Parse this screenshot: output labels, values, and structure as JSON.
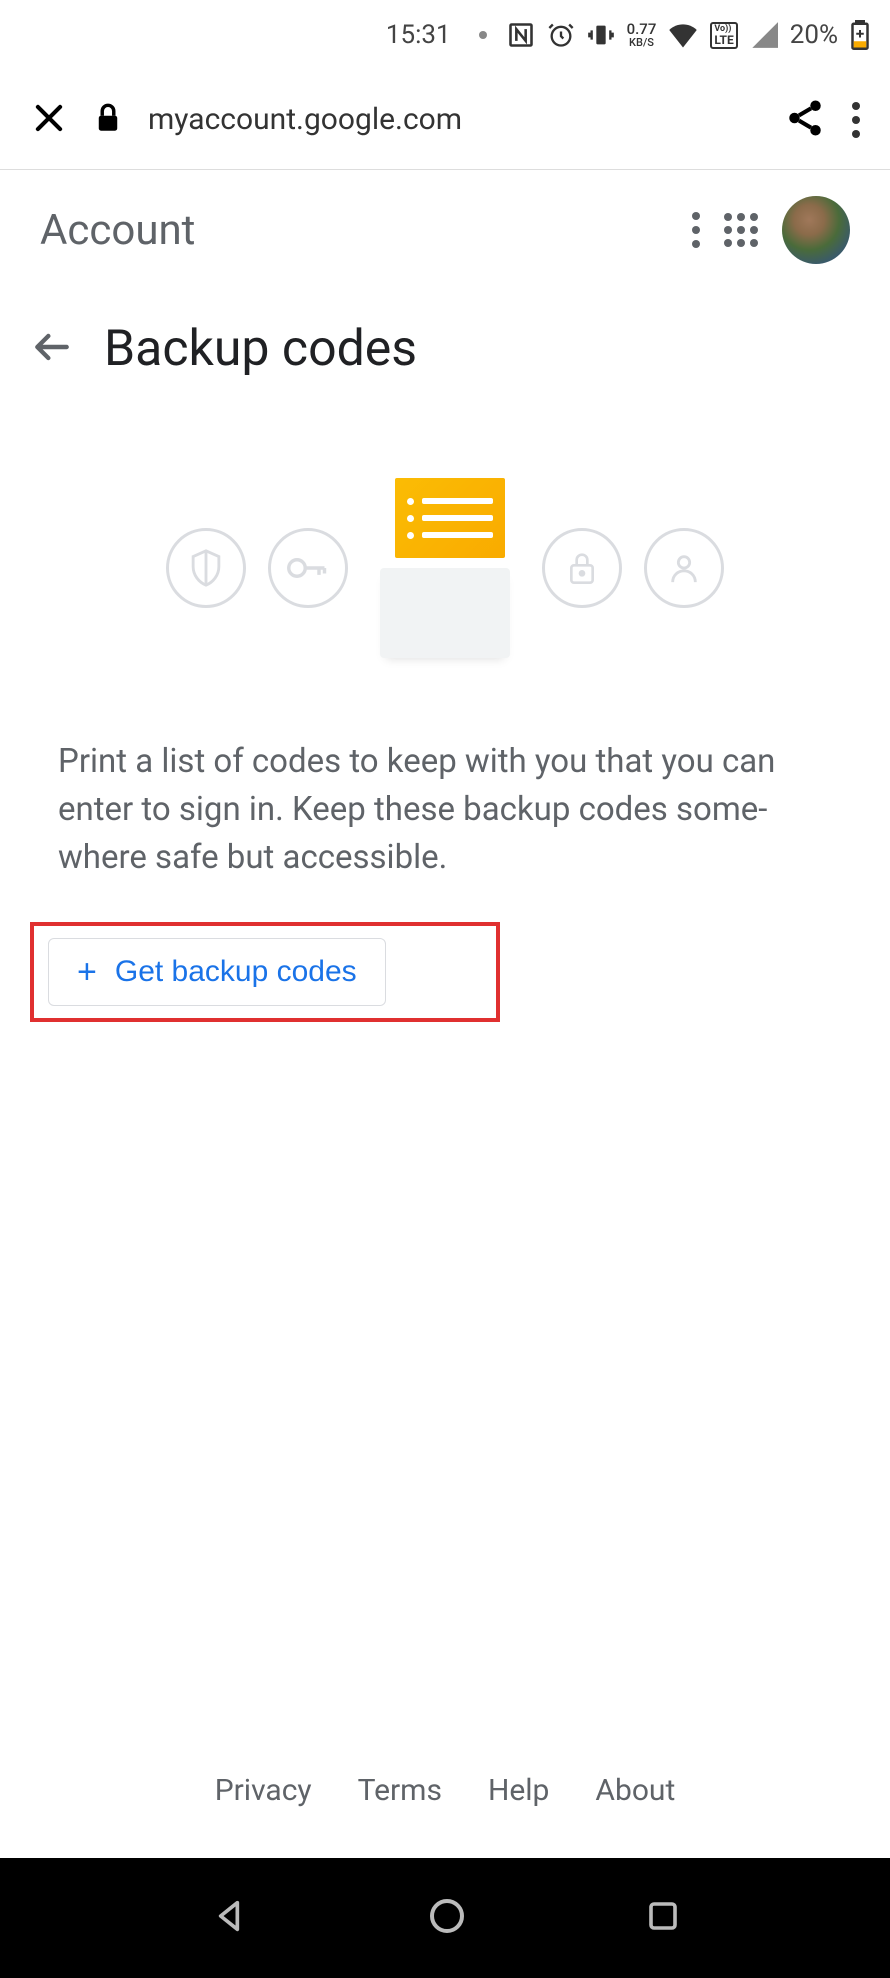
{
  "status": {
    "time": "15:31",
    "data_rate_value": "0.77",
    "data_rate_unit": "KB/S",
    "lte_label": "LTE",
    "battery_percent": "20%"
  },
  "browser": {
    "url": "myaccount.google.com"
  },
  "header": {
    "title": "Account"
  },
  "page": {
    "title": "Backup codes",
    "description": "Print a list of codes to keep with you that you can enter to sign in. Keep these backup codes some­where safe but accessible.",
    "get_codes_label": "Get backup codes"
  },
  "footer": {
    "links": [
      "Privacy",
      "Terms",
      "Help",
      "About"
    ]
  }
}
